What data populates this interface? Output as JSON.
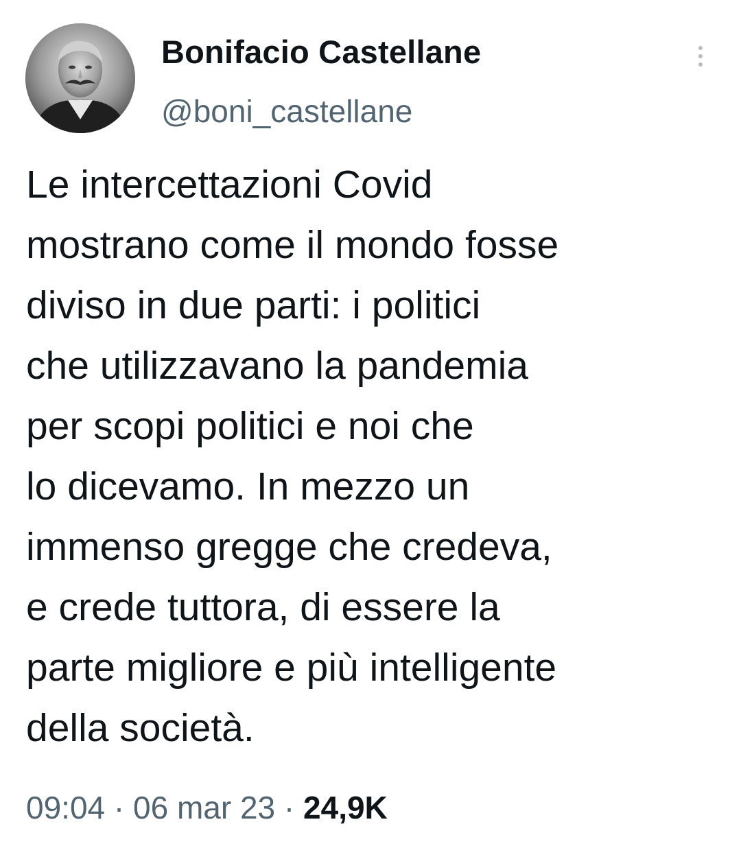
{
  "tweet": {
    "author": {
      "display_name": "Bonifacio Castellane",
      "handle": "@boni_castellane",
      "avatar_icon": "avatar-portrait"
    },
    "more_icon": "more-vertical-icon",
    "text_lines": [
      "Le intercettazioni Covid",
      "mostrano come il mondo fosse",
      "diviso in due parti: i politici",
      "che utilizzavano la pandemia",
      "per scopi politici e noi che",
      "lo dicevamo. In mezzo un",
      "immenso gregge che credeva,",
      "e crede tuttora, di essere la",
      "parte migliore e più intelligente",
      "della società."
    ],
    "meta": {
      "time": "09:04",
      "separator": " · ",
      "date": "06 mar 23",
      "views": "24,9K"
    }
  },
  "colors": {
    "text_primary": "#0f1419",
    "text_secondary": "#536471",
    "background": "#ffffff"
  }
}
